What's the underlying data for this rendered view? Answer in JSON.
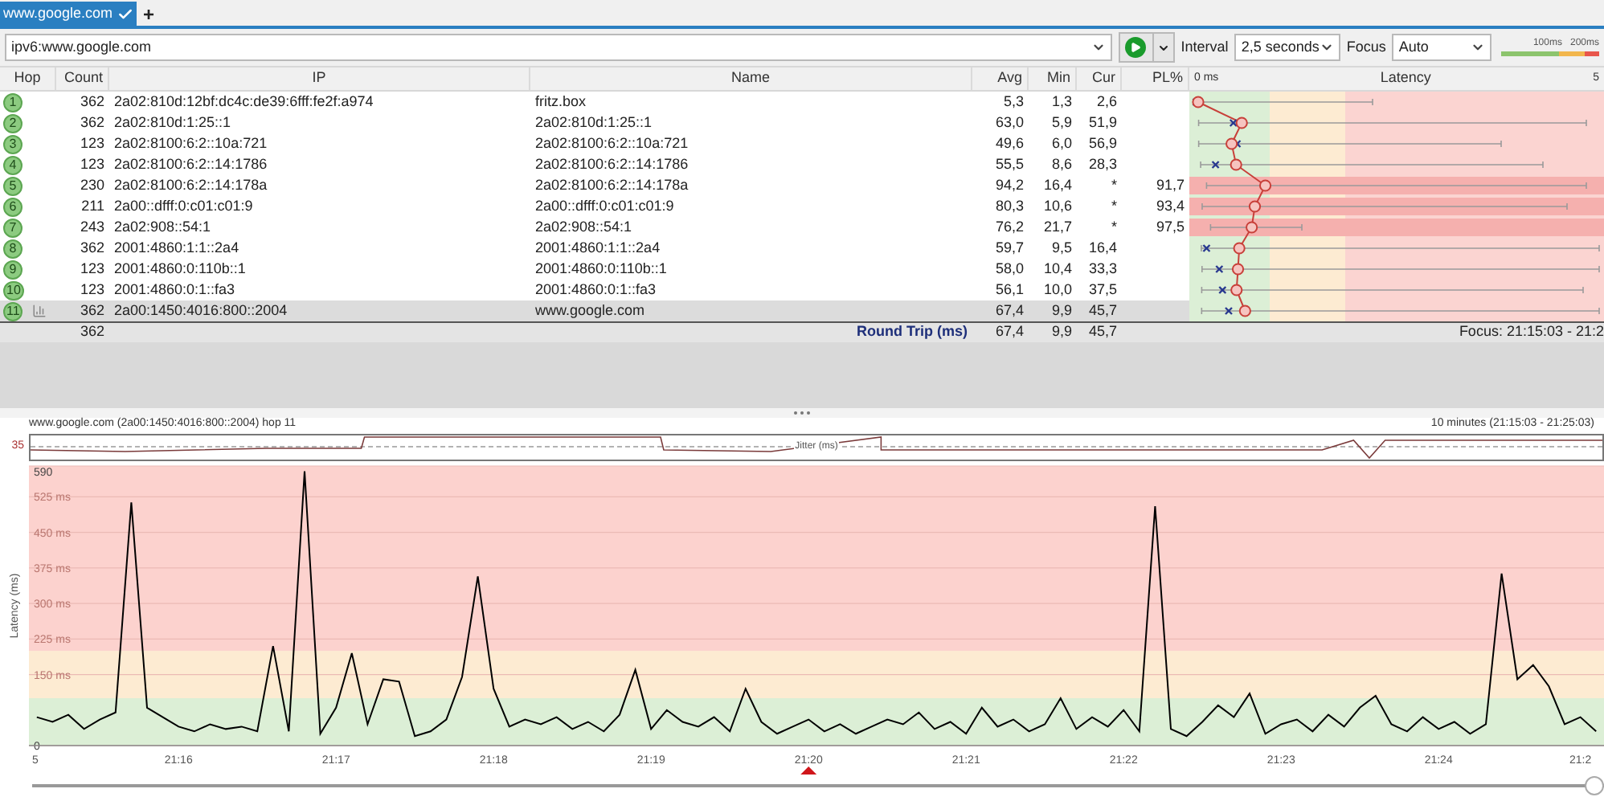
{
  "tabs": [
    {
      "label": "www.google.com",
      "selected": true
    }
  ],
  "new_tab": "+",
  "toolbar": {
    "target": "ipv6:www.google.com",
    "interval_label": "Interval",
    "interval": "2,5 seconds",
    "focus_label": "Focus",
    "focus": "Auto",
    "scale_labels": [
      "100ms",
      "200ms"
    ]
  },
  "table": {
    "columns": [
      "Hop",
      "Count",
      "IP",
      "Name",
      "Avg",
      "Min",
      "Cur",
      "PL%",
      "Latency"
    ],
    "latency_start": "0 ms",
    "latency_end": "5",
    "rows": [
      {
        "hop": "1",
        "count": "362",
        "ip": "2a02:810d:12bf:dc4c:de39:6fff:fe2f:a974",
        "name": "fritz.box",
        "avg": "5,3",
        "min": "1,3",
        "cur": "2,6",
        "pl": "",
        "selected": false
      },
      {
        "hop": "2",
        "count": "362",
        "ip": "2a02:810d:1:25::1",
        "name": "2a02:810d:1:25::1",
        "avg": "63,0",
        "min": "5,9",
        "cur": "51,9",
        "pl": "",
        "selected": false
      },
      {
        "hop": "3",
        "count": "123",
        "ip": "2a02:8100:6:2::10a:721",
        "name": "2a02:8100:6:2::10a:721",
        "avg": "49,6",
        "min": "6,0",
        "cur": "56,9",
        "pl": "",
        "selected": false
      },
      {
        "hop": "4",
        "count": "123",
        "ip": "2a02:8100:6:2::14:1786",
        "name": "2a02:8100:6:2::14:1786",
        "avg": "55,5",
        "min": "8,6",
        "cur": "28,3",
        "pl": "",
        "selected": false
      },
      {
        "hop": "5",
        "count": "230",
        "ip": "2a02:8100:6:2::14:178a",
        "name": "2a02:8100:6:2::14:178a",
        "avg": "94,2",
        "min": "16,4",
        "cur": "*",
        "pl": "91,7",
        "selected": false
      },
      {
        "hop": "6",
        "count": "211",
        "ip": "2a00::dfff:0:c01:c01:9",
        "name": "2a00::dfff:0:c01:c01:9",
        "avg": "80,3",
        "min": "10,6",
        "cur": "*",
        "pl": "93,4",
        "selected": false
      },
      {
        "hop": "7",
        "count": "243",
        "ip": "2a02:908::54:1",
        "name": "2a02:908::54:1",
        "avg": "76,2",
        "min": "21,7",
        "cur": "*",
        "pl": "97,5",
        "selected": false
      },
      {
        "hop": "8",
        "count": "362",
        "ip": "2001:4860:1:1::2a4",
        "name": "2001:4860:1:1::2a4",
        "avg": "59,7",
        "min": "9,5",
        "cur": "16,4",
        "pl": "",
        "selected": false
      },
      {
        "hop": "9",
        "count": "123",
        "ip": "2001:4860:0:110b::1",
        "name": "2001:4860:0:110b::1",
        "avg": "58,0",
        "min": "10,4",
        "cur": "33,3",
        "pl": "",
        "selected": false
      },
      {
        "hop": "10",
        "count": "123",
        "ip": "2001:4860:0:1::fa3",
        "name": "2001:4860:0:1::fa3",
        "avg": "56,1",
        "min": "10,0",
        "cur": "37,5",
        "pl": "",
        "selected": false
      },
      {
        "hop": "11",
        "count": "362",
        "ip": "2a00:1450:4016:800::2004",
        "name": "www.google.com",
        "avg": "67,4",
        "min": "9,9",
        "cur": "45,7",
        "pl": "",
        "selected": true
      }
    ],
    "summary": {
      "count": "362",
      "label": "Round Trip (ms)",
      "avg": "67,4",
      "min": "9,9",
      "cur": "45,7",
      "focus": "Focus: 21:15:03 - 21:2"
    }
  },
  "graph": {
    "title": "www.google.com (2a00:1450:4016:800::2004) hop 11",
    "range": "10 minutes (21:15:03 - 21:25:03)",
    "jitter_max": "35",
    "jitter_label": "Jitter (ms)",
    "chart_data": {
      "type": "line",
      "grid": true,
      "ylabel": "Latency (ms)",
      "ylim": [
        0,
        590
      ],
      "categories": [
        "5",
        null,
        null,
        null,
        null,
        null,
        null,
        null,
        null,
        "21:16",
        null,
        null,
        null,
        null,
        null,
        null,
        null,
        null,
        null,
        "21:17",
        null,
        null,
        null,
        null,
        null,
        null,
        null,
        null,
        null,
        "21:18",
        null,
        null,
        null,
        null,
        null,
        null,
        null,
        null,
        null,
        "21:19",
        null,
        null,
        null,
        null,
        null,
        null,
        null,
        null,
        null,
        "21:20",
        null,
        null,
        null,
        null,
        null,
        null,
        null,
        null,
        null,
        "21:21",
        null,
        null,
        null,
        null,
        null,
        null,
        null,
        null,
        null,
        "21:22",
        null,
        null,
        null,
        null,
        null,
        null,
        null,
        null,
        null,
        "21:23",
        null,
        null,
        null,
        null,
        null,
        null,
        null,
        null,
        null,
        "21:24",
        null,
        null,
        null,
        null,
        null,
        null,
        null,
        null,
        "21:2",
        null
      ],
      "yticks": [
        {
          "value": 0,
          "label": "0"
        },
        {
          "value": 150,
          "label": "150 ms"
        },
        {
          "value": 225,
          "label": "225 ms"
        },
        {
          "value": 300,
          "label": "300 ms"
        },
        {
          "value": 375,
          "label": "375 ms"
        },
        {
          "value": 450,
          "label": "450 ms"
        },
        {
          "value": 525,
          "label": "525 ms"
        },
        {
          "value": 590,
          "label": "590"
        }
      ],
      "series": [
        {
          "color": "#000000",
          "values": [
            60,
            50,
            65,
            35,
            55,
            70,
            513,
            80,
            60,
            40,
            30,
            45,
            35,
            40,
            30,
            210,
            30,
            579,
            25,
            80,
            195,
            45,
            140,
            135,
            20,
            30,
            55,
            145,
            357,
            120,
            40,
            55,
            45,
            60,
            35,
            50,
            30,
            65,
            160,
            35,
            75,
            50,
            40,
            60,
            30,
            120,
            50,
            25,
            40,
            55,
            30,
            45,
            25,
            40,
            55,
            45,
            70,
            35,
            50,
            25,
            80,
            40,
            55,
            30,
            45,
            100,
            35,
            60,
            40,
            75,
            30,
            505,
            35,
            20,
            50,
            85,
            60,
            110,
            25,
            45,
            55,
            30,
            65,
            40,
            80,
            105,
            45,
            30,
            60,
            35,
            50,
            25,
            45,
            363,
            140,
            170,
            125,
            45,
            60,
            30
          ]
        }
      ]
    }
  },
  "timeline": {
    "level": 1
  }
}
